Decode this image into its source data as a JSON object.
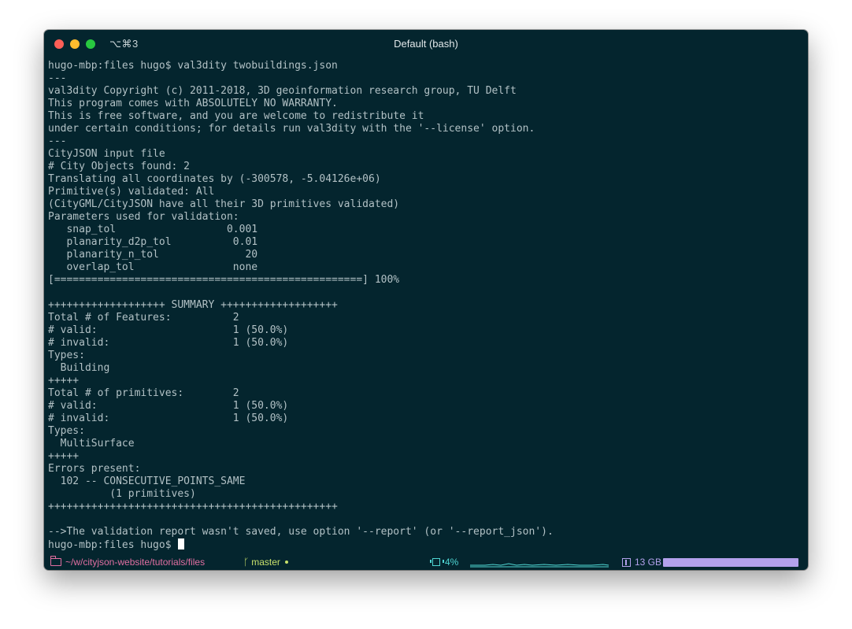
{
  "window": {
    "shortcut": "⌥⌘3",
    "title": "Default (bash)"
  },
  "terminal": {
    "lines": [
      "hugo-mbp:files hugo$ val3dity twobuildings.json",
      "---",
      "val3dity Copyright (c) 2011-2018, 3D geoinformation research group, TU Delft",
      "This program comes with ABSOLUTELY NO WARRANTY.",
      "This is free software, and you are welcome to redistribute it",
      "under certain conditions; for details run val3dity with the '--license' option.",
      "---",
      "CityJSON input file",
      "# City Objects found: 2",
      "Translating all coordinates by (-300578, -5.04126e+06)",
      "Primitive(s) validated: All",
      "(CityGML/CityJSON have all their 3D primitives validated)",
      "Parameters used for validation:",
      "   snap_tol                  0.001",
      "   planarity_d2p_tol          0.01",
      "   planarity_n_tol              20",
      "   overlap_tol                none",
      "[==================================================] 100%",
      "",
      "+++++++++++++++++++ SUMMARY +++++++++++++++++++",
      "Total # of Features:          2",
      "# valid:                      1 (50.0%)",
      "# invalid:                    1 (50.0%)",
      "Types:",
      "  Building",
      "+++++",
      "Total # of primitives:        2",
      "# valid:                      1 (50.0%)",
      "# invalid:                    1 (50.0%)",
      "Types:",
      "  MultiSurface",
      "+++++",
      "Errors present:",
      "  102 -- CONSECUTIVE_POINTS_SAME",
      "          (1 primitives)",
      "+++++++++++++++++++++++++++++++++++++++++++++++",
      "",
      "-->The validation report wasn't saved, use option '--report' (or '--report_json').",
      "hugo-mbp:files hugo$ "
    ]
  },
  "statusbar": {
    "path": "~/w/cityjson-website/tutorials/files",
    "branch": "master",
    "cpu": "4%",
    "memory": "13 GB",
    "memory_fill": 1.0
  },
  "colors": {
    "background": "#04252e",
    "text": "#b2c1c5",
    "path": "#e26fa2",
    "branch": "#c8e06b",
    "cpu": "#4fd6d3",
    "memory": "#b3a1ec"
  },
  "icons": {
    "folder": "folder-icon",
    "branch": "git-branch-icon",
    "cpu": "cpu-chip-icon",
    "memory": "memory-icon"
  }
}
